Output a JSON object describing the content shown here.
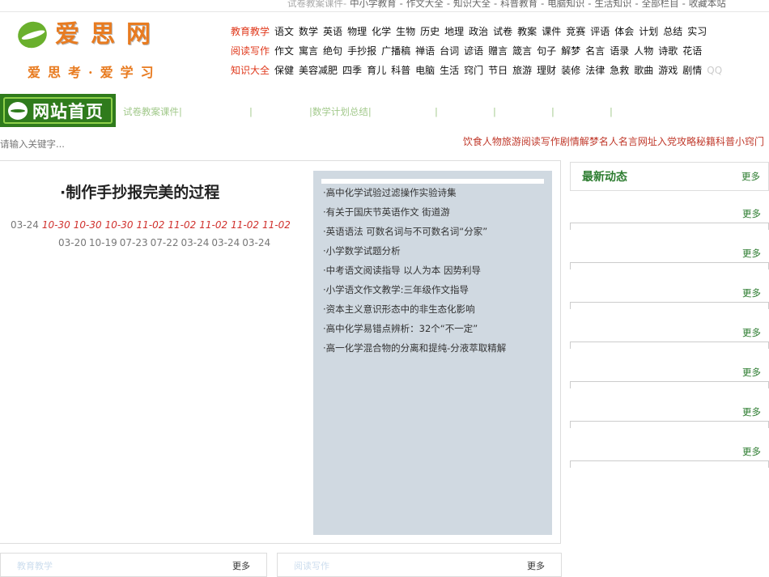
{
  "topbar": [
    "试卷教案课件-",
    "中小学教育",
    "-",
    "作文大全",
    "-",
    "知识大全",
    "-",
    "科普教育",
    "-",
    "电脑知识",
    "-",
    "生活知识",
    "-",
    "全部栏目",
    "-",
    "收藏本站"
  ],
  "logo": {
    "chars": [
      "爱",
      "思",
      "网"
    ],
    "slogan": "爱思考·爱学习"
  },
  "nav": [
    {
      "cat": "教育教学",
      "items": [
        "语文",
        "数学",
        "英语",
        "物理",
        "化学",
        "生物",
        "历史",
        "地理",
        "政治",
        "试卷",
        "教案",
        "课件",
        "竞赛",
        "评语",
        "体会",
        "计划",
        "总结",
        "实习"
      ]
    },
    {
      "cat": "阅读写作",
      "items": [
        "作文",
        "寓言",
        "绝句",
        "手抄报",
        "广播稿",
        "禅语",
        "台词",
        "谚语",
        "赠言",
        "箴言",
        "句子",
        "解梦",
        "名言",
        "语录",
        "人物",
        "诗歌",
        "花语"
      ]
    },
    {
      "cat": "知识大全",
      "items": [
        "保健",
        "美容减肥",
        "四季",
        "育儿",
        "科普",
        "电脑",
        "生活",
        "窍门",
        "节日",
        "旅游",
        "理财",
        "装修",
        "法律",
        "急救",
        "歌曲",
        "游戏",
        "剧情"
      ],
      "extra": "QQ"
    }
  ],
  "home_label": "网站首页",
  "sublinks": [
    "试卷教案课件|",
    "|",
    "|数学计划总结|",
    "|",
    "|",
    "|",
    "|"
  ],
  "search": {
    "placeholder": "请输入关键字..."
  },
  "hot": [
    "饮食",
    "人物",
    "旅游",
    "阅读写作",
    "剧情",
    "解梦",
    "名人名言",
    "网址",
    "入党",
    "攻略秘籍",
    "科普",
    "小窍门"
  ],
  "article": {
    "title": "·制作手抄报完美的过程",
    "dates_first": "03-24",
    "dates_red": [
      "10-30",
      "10-30",
      "10-30",
      "11-02",
      "11-02",
      "11-02",
      "11-02",
      "11-02"
    ],
    "dates_second": [
      "03-20",
      "10-19",
      "07-23",
      "07-22",
      "03-24",
      "03-24",
      "03-24"
    ]
  },
  "related": [
    "·高中化学试验过滤操作实验诗集",
    "·有关于国庆节英语作文 街道游",
    "·英语语法 可数名词与不可数名词“分家”",
    "·小学数学试题分析",
    "·中考语文阅读指导 以人为本 因势利导",
    "·小学语文作文教学:三年级作文指导",
    "·资本主义意识形态中的非生态化影响",
    "·高中化学易错点辨析：32个“不一定”",
    "·高一化学混合物的分离和提纯-分液萃取精解"
  ],
  "sidebar": {
    "title": "最新动态",
    "more": "更多",
    "blocks": [
      "更多",
      "更多",
      "更多",
      "更多",
      "更多",
      "更多",
      "更多"
    ]
  },
  "bottom": {
    "left_title": "教育教学",
    "left_more": "更多",
    "right_title": "阅读写作",
    "right_more": "更多"
  }
}
